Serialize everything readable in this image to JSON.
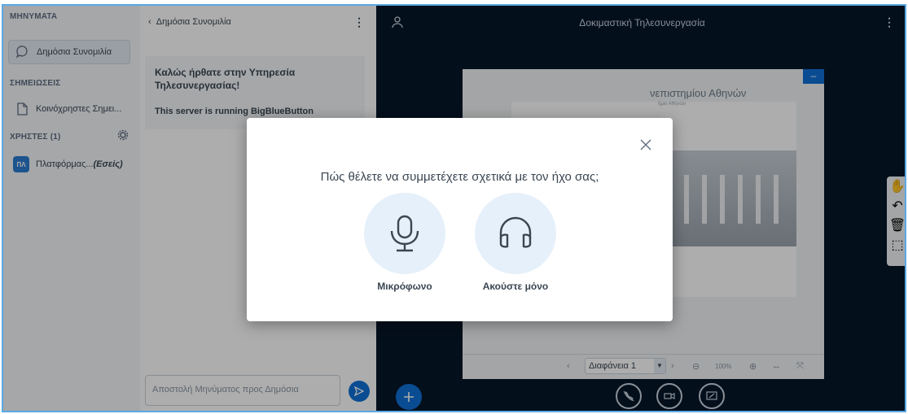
{
  "sidebar": {
    "messages_title": "ΜΗΝΥΜΑΤΑ",
    "public_chat": "Δημόσια Συνομιλία",
    "notes_title": "ΣΗΜΕΙΩΣΕΙΣ",
    "shared_notes": "Κοινόχρηστες Σημει...",
    "users_title": "ΧΡΗΣΤΕΣ (1)",
    "user_avatar": "ΠΛ",
    "user_name": "Πλατφόρμας...",
    "user_self": "(Εσείς)"
  },
  "chat": {
    "back_label": "Δημόσια Συνομιλία",
    "welcome": "Καλώς ήρθατε στην Υπηρεσία Τηλεσυνεργασίας!",
    "server_line": "This server is running BigBlueButton",
    "input_placeholder": "Αποστολή Μηνύματος προς Δημόσια"
  },
  "main": {
    "title": "Δοκιμαστική Τηλεσυνεργασία",
    "slide_title": "νεπιστημίου Αθηνών",
    "slide_subtitle": "ήμιο Αθηνών",
    "slide_select": "Διαφάνεια 1",
    "zoom": "100%"
  },
  "modal": {
    "question": "Πώς θέλετε να συμμετέχετε σχετικά με τον ήχο σας;",
    "microphone_label": "Μικρόφωνο",
    "listen_label": "Ακούστε μόνο"
  },
  "colors": {
    "accent": "#0f70d7",
    "main_bg": "#06172a",
    "option_bg": "#e6f0fa"
  }
}
